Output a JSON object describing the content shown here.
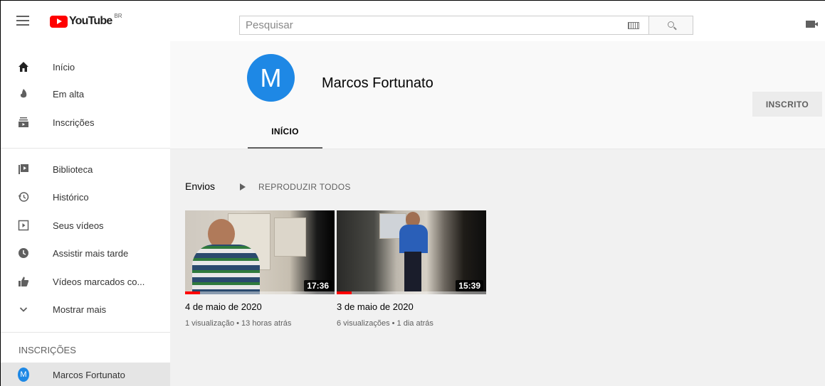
{
  "header": {
    "logo_text": "YouTube",
    "logo_country": "BR",
    "search_placeholder": "Pesquisar"
  },
  "sidebar": {
    "items": [
      {
        "label": "Início",
        "icon": "home-icon"
      },
      {
        "label": "Em alta",
        "icon": "trending-icon"
      },
      {
        "label": "Inscrições",
        "icon": "subscriptions-icon"
      },
      {
        "label": "Biblioteca",
        "icon": "library-icon"
      },
      {
        "label": "Histórico",
        "icon": "history-icon"
      },
      {
        "label": "Seus vídeos",
        "icon": "your-videos-icon"
      },
      {
        "label": "Assistir mais tarde",
        "icon": "watch-later-icon"
      },
      {
        "label": "Vídeos marcados co...",
        "icon": "liked-icon"
      },
      {
        "label": "Mostrar mais",
        "icon": "chevron-down-icon"
      }
    ],
    "subscriptions_title": "INSCRIÇÕES",
    "subscriptions": [
      {
        "label": "Marcos Fortunato",
        "avatar_letter": "M"
      }
    ]
  },
  "channel": {
    "avatar_letter": "M",
    "name": "Marcos Fortunato",
    "subscribe_label": "INSCRITO",
    "tab_label": "INÍCIO",
    "accent": "#1e88e5"
  },
  "shelf": {
    "title": "Envios",
    "play_all_label": "REPRODUZIR TODOS",
    "videos": [
      {
        "duration": "17:36",
        "title": "4 de maio de 2020",
        "meta": "1 visualização • 13 horas atrás",
        "progress_fraction": 0.1
      },
      {
        "duration": "15:39",
        "title": "3 de maio de 2020",
        "meta": "6 visualizações • 1 dia atrás",
        "progress_fraction": 0.1
      }
    ]
  }
}
